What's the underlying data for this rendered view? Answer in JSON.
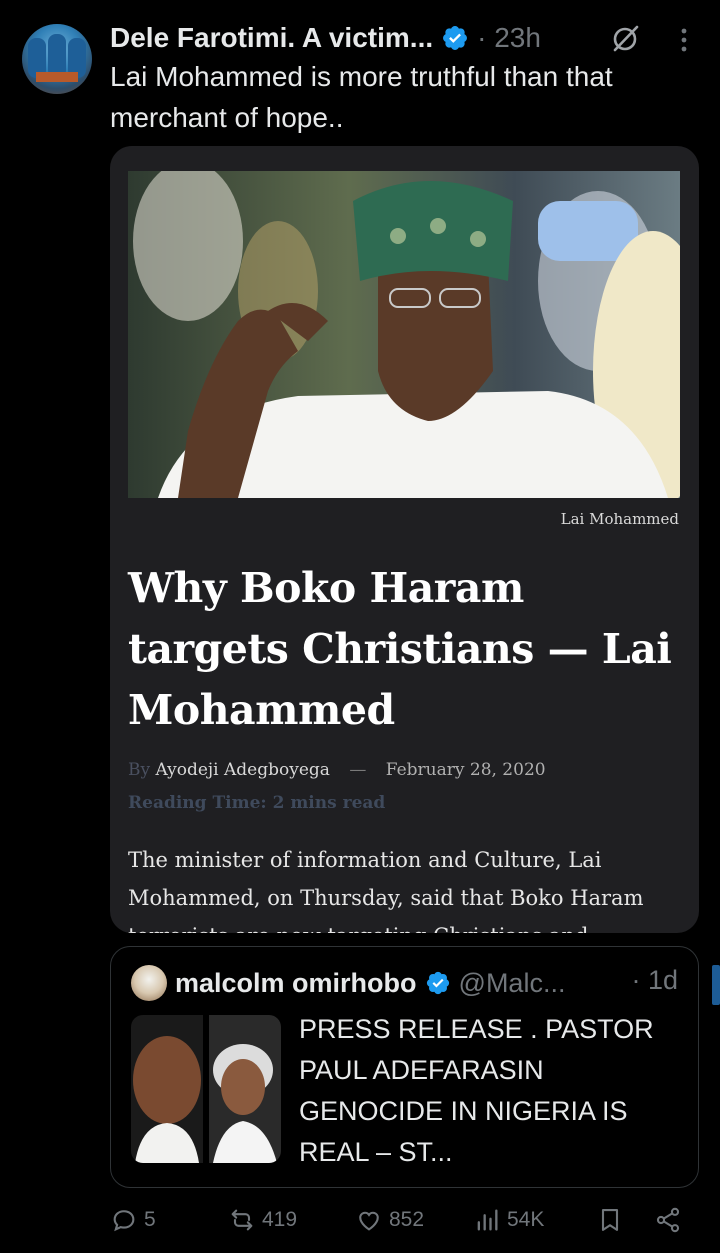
{
  "tweet": {
    "author": "Dele Farotimi. A victim...",
    "time": "· 23h",
    "text": "Lai Mohammed is more truthful than that merchant of hope..",
    "verified_color": "#1d9bf0"
  },
  "article": {
    "photo_caption": "Lai Mohammed",
    "headline": "Why Boko Haram targets Christians — Lai Mohammed",
    "by_prefix": "By",
    "author": "Ayodeji Adegboyega",
    "date": "February 28, 2020",
    "reading_time": "Reading Time: 2 mins read",
    "excerpt": "The minister of information and Culture, Lai Mohammed, on Thursday, said that Boko Haram terrorists are now targeting Christians and"
  },
  "quoted": {
    "author": "malcolm omirhobo",
    "handle": "@Malc...",
    "time": "· 1d",
    "text": "PRESS RELEASE . PASTOR PAUL ADEFARASIN GENOCIDE IN NIGERIA IS REAL – ST..."
  },
  "actions": {
    "replies": "5",
    "reposts": "419",
    "likes": "852",
    "views": "54K"
  },
  "icons": [
    "grok-icon",
    "more-icon",
    "verified-icon",
    "reply-icon",
    "repost-icon",
    "like-icon",
    "views-icon",
    "bookmark-icon",
    "share-icon"
  ],
  "colors": {
    "background": "#000000",
    "muted": "#71767b",
    "text": "#e7e9ea",
    "accent": "#1d9bf0",
    "card": "#1f1f22"
  }
}
